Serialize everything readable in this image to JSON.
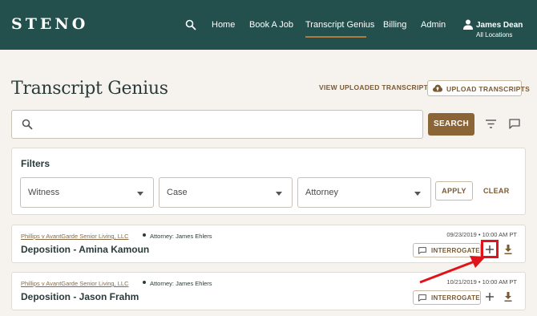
{
  "header": {
    "logo": "STENO",
    "nav": [
      "Home",
      "Book A Job",
      "Transcript Genius",
      "Billing",
      "Admin"
    ],
    "user_name": "James Dean",
    "user_location": "All Locations"
  },
  "page": {
    "title": "Transcript Genius",
    "view_uploaded_label": "VIEW UPLOADED TRANSCRIPTS",
    "upload_label": "UPLOAD TRANSCRIPTS"
  },
  "search": {
    "placeholder": "",
    "button_label": "SEARCH"
  },
  "filters": {
    "title": "Filters",
    "witness": "Witness",
    "case": "Case",
    "attorney": "Attorney",
    "apply_label": "APPLY",
    "clear_label": "CLEAR"
  },
  "results": [
    {
      "case": "Phillips v AvantGarde Senior Living, LLC",
      "attorney": "Attorney: James Ehlers",
      "title": "Deposition - Amina Kamoun",
      "datetime": "09/23/2019 • 10:00 AM PT",
      "interrogate_label": "INTERROGATE"
    },
    {
      "case": "Phillips v AvantGarde Senior Living, LLC",
      "attorney": "Attorney: James Ehlers",
      "title": "Deposition - Jason Frahm",
      "datetime": "10/21/2019 • 10:00 AM PT",
      "interrogate_label": "INTERROGATE"
    }
  ],
  "colors": {
    "header_bg": "#23504d",
    "accent_brown": "#8c6536",
    "highlight_red": "#e0131a"
  }
}
